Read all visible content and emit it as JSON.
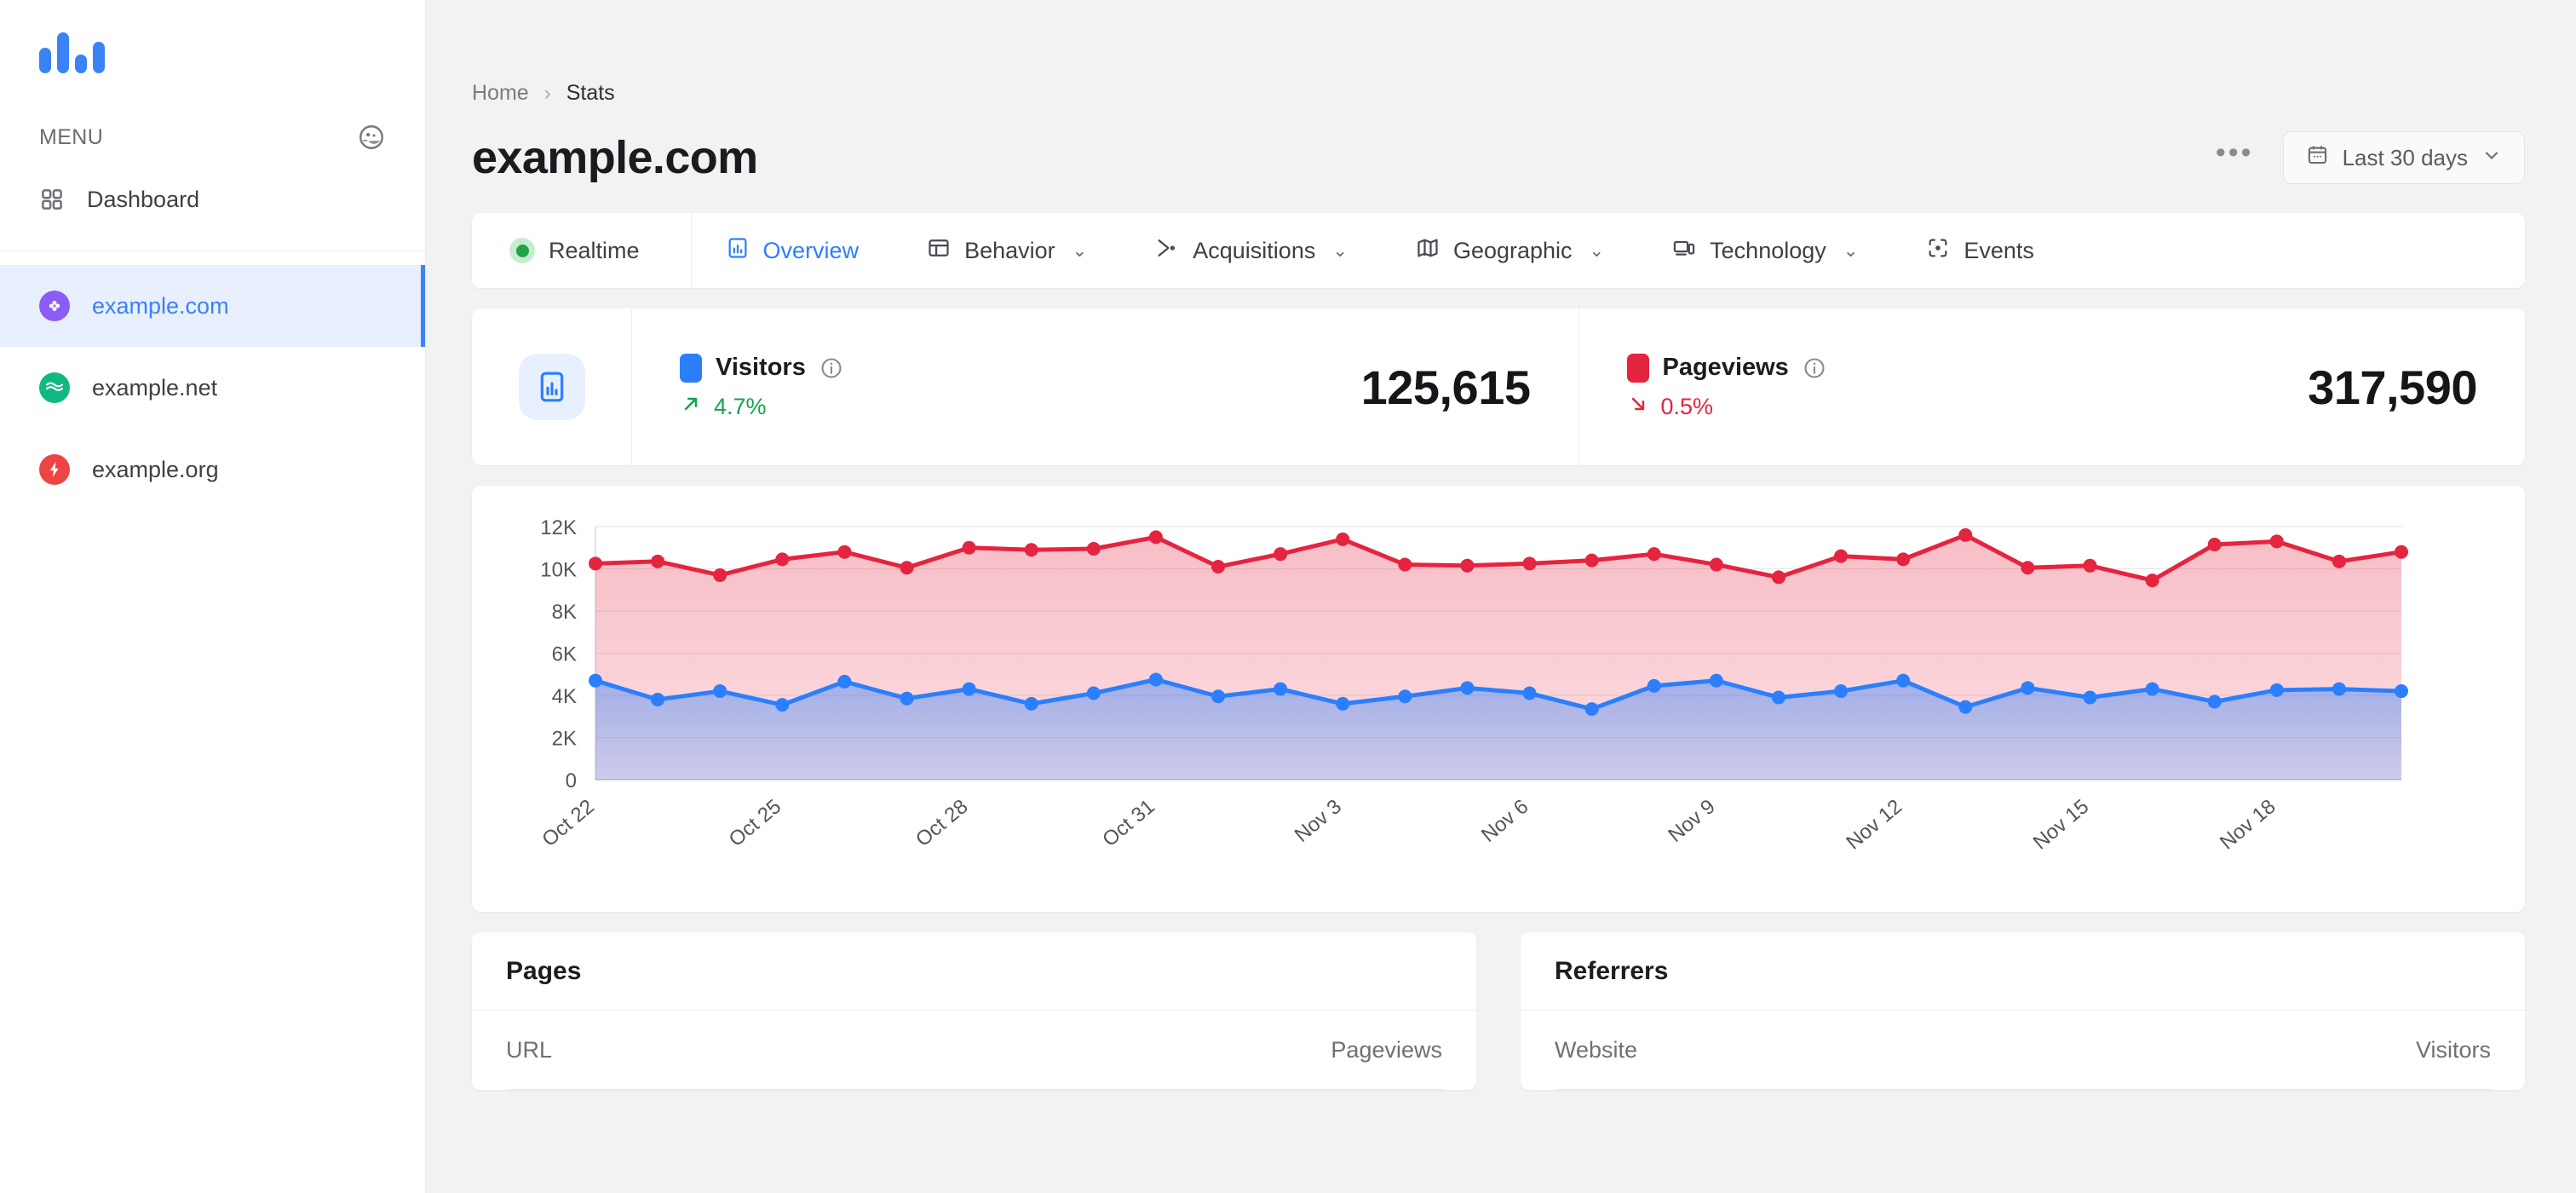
{
  "sidebar": {
    "logo_name": "bar-chart-logo",
    "menu_label": "MENU",
    "account_icon": "account-circle-icon",
    "nav": [
      {
        "label": "Dashboard",
        "icon": "grid-icon"
      }
    ],
    "sites": [
      {
        "label": "example.com",
        "icon": "flower-favicon",
        "color": "#8b5cf6",
        "active": true
      },
      {
        "label": "example.net",
        "icon": "wave-favicon",
        "color": "#10b981",
        "active": false
      },
      {
        "label": "example.org",
        "icon": "bolt-favicon",
        "color": "#ef4444",
        "active": false
      }
    ]
  },
  "header": {
    "breadcrumb": {
      "home": "Home",
      "separator": "›",
      "current": "Stats"
    },
    "title": "example.com",
    "more_label": "•••",
    "daterange": {
      "label": "Last 30 days",
      "icon": "calendar-icon",
      "caret": "⌄"
    }
  },
  "tabs": [
    {
      "label": "Realtime",
      "icon": "live-dot-icon",
      "active": false,
      "caret": ""
    },
    {
      "label": "Overview",
      "icon": "chart-icon",
      "active": true,
      "caret": ""
    },
    {
      "label": "Behavior",
      "icon": "table-icon",
      "active": false,
      "caret": "⌄"
    },
    {
      "label": "Acquisitions",
      "icon": "branch-icon",
      "active": false,
      "caret": "⌄"
    },
    {
      "label": "Geographic",
      "icon": "map-icon",
      "active": false,
      "caret": "⌄"
    },
    {
      "label": "Technology",
      "icon": "devices-icon",
      "active": false,
      "caret": "⌄"
    },
    {
      "label": "Events",
      "icon": "focus-dot-icon",
      "active": false,
      "caret": ""
    }
  ],
  "metrics": {
    "panel_icon": "report-icon",
    "items": [
      {
        "name": "Visitors",
        "color": "#2b7fff",
        "info_icon": "info-icon",
        "delta": "4.7%",
        "delta_dir": "up",
        "delta_icon": "arrow-up-right-icon",
        "delta_color": "#16a34a",
        "value": "125,615"
      },
      {
        "name": "Pageviews",
        "color": "#e5243f",
        "info_icon": "info-icon",
        "delta": "0.5%",
        "delta_dir": "down",
        "delta_icon": "arrow-down-right-icon",
        "delta_color": "#e5243f",
        "value": "317,590"
      }
    ]
  },
  "chart_data": {
    "type": "area",
    "title": "",
    "xlabel": "",
    "ylabel": "",
    "ylim": [
      0,
      12000
    ],
    "yticks": [
      0,
      2000,
      4000,
      6000,
      8000,
      10000,
      12000
    ],
    "ytick_labels": [
      "0",
      "2K",
      "4K",
      "6K",
      "8K",
      "10K",
      "12K"
    ],
    "grid": true,
    "legend": "top",
    "x": [
      "Oct 22",
      "Oct 23",
      "Oct 24",
      "Oct 25",
      "Oct 26",
      "Oct 27",
      "Oct 28",
      "Oct 29",
      "Oct 30",
      "Oct 31",
      "Nov 1",
      "Nov 2",
      "Nov 3",
      "Nov 4",
      "Nov 5",
      "Nov 6",
      "Nov 7",
      "Nov 8",
      "Nov 9",
      "Nov 10",
      "Nov 11",
      "Nov 12",
      "Nov 13",
      "Nov 14",
      "Nov 15",
      "Nov 16",
      "Nov 17",
      "Nov 18",
      "Nov 19",
      "Nov 20"
    ],
    "xtick_labels": [
      "Oct 22",
      "Oct 25",
      "Oct 28",
      "Oct 31",
      "Nov 3",
      "Nov 6",
      "Nov 9",
      "Nov 12",
      "Nov 15",
      "Nov 18"
    ],
    "xtick_indices": [
      0,
      3,
      6,
      9,
      12,
      15,
      18,
      21,
      24,
      27
    ],
    "series": [
      {
        "name": "Pageviews",
        "color": "#e5243f",
        "fill": "rgba(229,36,63,0.22)",
        "values": [
          10250,
          10350,
          9700,
          10450,
          10800,
          10050,
          11000,
          10900,
          10950,
          11500,
          10100,
          10700,
          11400,
          10200,
          10150,
          10250,
          10400,
          10700,
          10200,
          9600,
          10600,
          10450,
          11600,
          10050,
          10150,
          9450,
          11150,
          11300,
          10350,
          10800
        ]
      },
      {
        "name": "Visitors",
        "color": "#2b7fff",
        "fill": "rgba(91,107,200,0.26)",
        "values": [
          4700,
          3800,
          4200,
          3550,
          4650,
          3850,
          4300,
          3600,
          4100,
          4750,
          3950,
          4300,
          3600,
          3950,
          4350,
          4100,
          3350,
          4450,
          4700,
          3900,
          4200,
          4700,
          3450,
          4350,
          3900,
          4300,
          3700,
          4250,
          4300,
          4200
        ]
      }
    ]
  },
  "panels": [
    {
      "title": "Pages",
      "col_left": "URL",
      "col_right": "Pageviews"
    },
    {
      "title": "Referrers",
      "col_left": "Website",
      "col_right": "Visitors"
    }
  ]
}
